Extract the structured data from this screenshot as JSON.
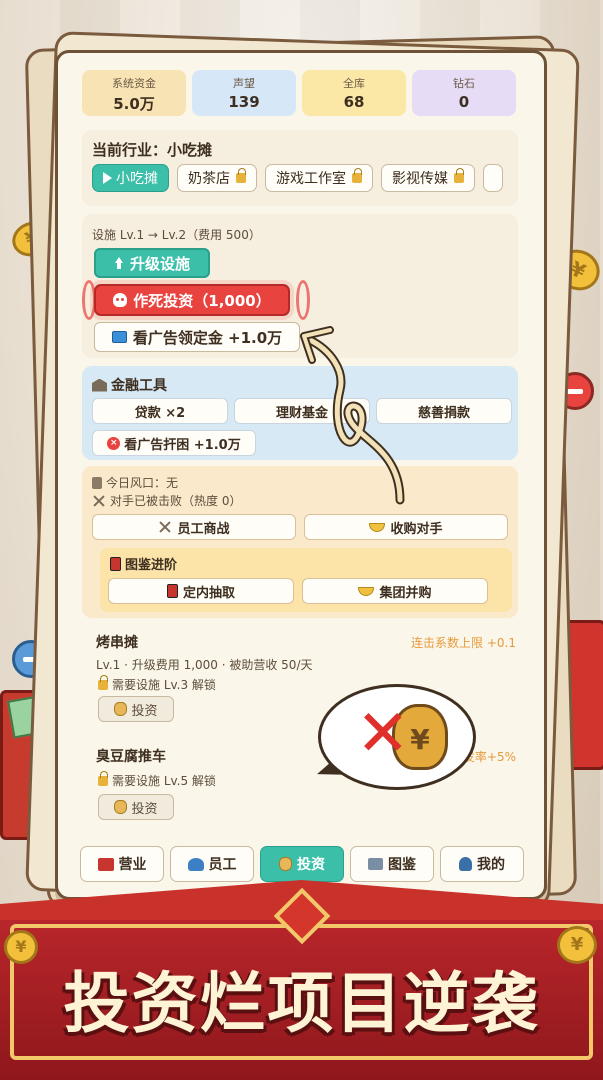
{
  "stats": [
    {
      "label": "系统资金",
      "value": "5.0万",
      "color": "#f7e3b3"
    },
    {
      "label": "声望",
      "value": "139",
      "color": "#d6e8f7"
    },
    {
      "label": "全库",
      "value": "68",
      "color": "#fbe7a6"
    },
    {
      "label": "钻石",
      "value": "0",
      "color": "#e6dcf5"
    }
  ],
  "industry": {
    "title": "当前行业：小吃摊",
    "tabs": [
      {
        "label": "小吃摊",
        "active": true
      },
      {
        "label": "奶茶店",
        "locked": true
      },
      {
        "label": "游戏工作室",
        "locked": true
      },
      {
        "label": "影视传媒",
        "locked": true
      }
    ]
  },
  "facility": {
    "text": "设施 Lv.1 → Lv.2（费用 500）",
    "upgrade_label": "升级设施",
    "die_invest_label": "作死投资（1,000）",
    "ad_label": "看广告领定金 +1.0万"
  },
  "finance": {
    "title": "金融工具",
    "buttons": [
      "贷款 ×2",
      "理财基金",
      "慈善捐款"
    ],
    "ad_label": "看广告扞困 +1.0万"
  },
  "market": {
    "wind": "今日风口：无",
    "rival": "对手已被击败（热度 0）",
    "war_label": "员工商战",
    "acquire_label": "收购对手",
    "collection": {
      "title": "图鉴进阶",
      "draw_label": "定内抽取",
      "merge_label": "集团并购"
    }
  },
  "items": [
    {
      "name": "烤串摊",
      "bonus": "连击系数上限 +0.1",
      "desc": "Lv.1 · 升级费用 1,000 · 被助营收 50/天",
      "lock": "需要设施 Lv.3 解锁",
      "invest_label": "投资"
    },
    {
      "name": "臭豆腐推车",
      "bonus": "发率+5%",
      "lock": "需要设施 Lv.5 解锁",
      "invest_label": "投资"
    }
  ],
  "nav": [
    {
      "label": "营业",
      "icon": "shop-icon"
    },
    {
      "label": "员工",
      "icon": "people-icon"
    },
    {
      "label": "投资",
      "icon": "moneybag-icon",
      "active": true
    },
    {
      "label": "图鉴",
      "icon": "book-icon"
    },
    {
      "label": "我的",
      "icon": "user-icon"
    }
  ],
  "bubble_symbol": "¥",
  "slogan": "投资烂项目逆袭",
  "colors": {
    "teal": "#3cbfa8",
    "red": "#e8433f",
    "banner": "#b8262a"
  }
}
